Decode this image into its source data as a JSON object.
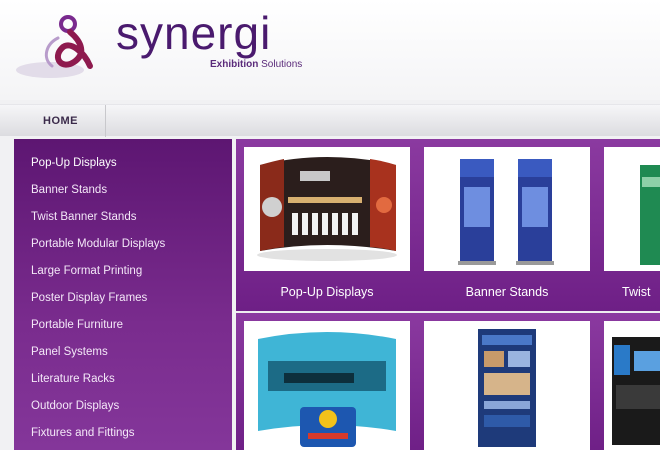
{
  "brand": {
    "name": "synergi",
    "tagline_bold": "Exhibition",
    "tagline_rest": " Solutions",
    "accent": "#6e1f86",
    "dark": "#4a1a6e"
  },
  "nav": {
    "home_label": "HOME"
  },
  "sidebar": {
    "items": [
      {
        "label": "Pop-Up Displays"
      },
      {
        "label": "Banner Stands"
      },
      {
        "label": "Twist Banner Stands"
      },
      {
        "label": "Portable Modular Displays"
      },
      {
        "label": "Large Format Printing"
      },
      {
        "label": "Poster Display Frames"
      },
      {
        "label": "Portable Furniture"
      },
      {
        "label": "Panel Systems"
      },
      {
        "label": "Literature Racks"
      },
      {
        "label": "Outdoor Displays"
      },
      {
        "label": "Fixtures and Fittings"
      }
    ]
  },
  "products": [
    {
      "label": "Pop-Up Displays",
      "image": "popup-display-image"
    },
    {
      "label": "Banner Stands",
      "image": "banner-stands-image"
    },
    {
      "label": "Twist",
      "image": "twist-banner-image"
    },
    {
      "label": "",
      "image": "popup-counter-image"
    },
    {
      "label": "",
      "image": "poster-banner-image"
    },
    {
      "label": "",
      "image": "modular-display-image"
    }
  ]
}
